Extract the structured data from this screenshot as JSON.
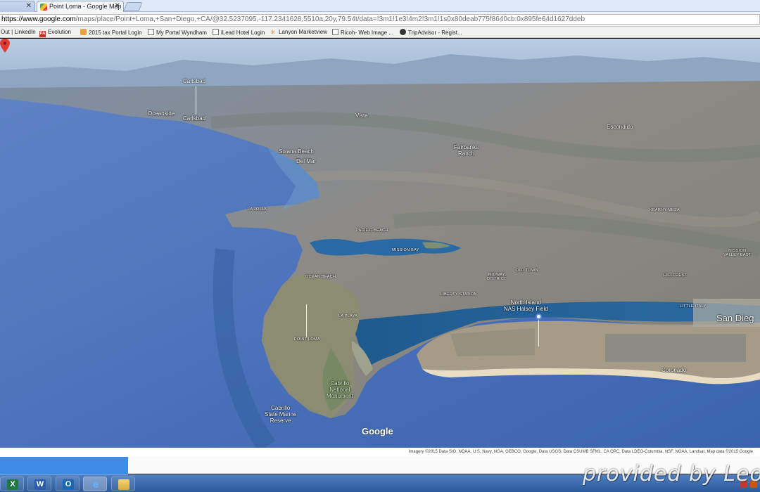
{
  "browser": {
    "tabs": [
      {
        "label": "",
        "active": false
      },
      {
        "label": "Point Loma - Google Map",
        "active": true
      }
    ],
    "close_glyph": "✕",
    "url_host": "https://www.google.com",
    "url_path": "/maps/place/Point+Loma,+San+Diego,+CA/@32.5237095,-117.2341628,5510a,20y,79.54t/data=!3m1!1e3!4m2!3m1!1s0x80deab775f8640cb:0x895fe64d1627ddeb"
  },
  "bookmarks": [
    {
      "label": "Out | LinkedIn",
      "icon": "none"
    },
    {
      "label": "Evolution",
      "icon": "pa-icon"
    },
    {
      "label": "2015 tax  Portal Login",
      "icon": "briefcase-icon"
    },
    {
      "label": "My Portal Wyndham",
      "icon": "document-icon"
    },
    {
      "label": "iLead Hotel Login",
      "icon": "document-icon"
    },
    {
      "label": "Lanyon Marketview",
      "icon": "lanyon-icon"
    },
    {
      "label": "Ricoh- Web Image ...",
      "icon": "document-icon"
    },
    {
      "label": "TripAdvisor - Regist...",
      "icon": "owl-icon"
    }
  ],
  "map": {
    "labels": {
      "carlsbad_1": "Carlsbad",
      "carlsbad_2": "Carlsbad",
      "oceanside": "Oceanside",
      "vista": "Vista",
      "escondido": "Escondido",
      "solana_beach": "Solana Beach",
      "del_mar": "Del Mar",
      "fairbanks_ranch": "Fairbanks\nRanch",
      "la_jolla": "LA JOLLA",
      "pacific_beach": "PACIFIC BEACH",
      "kearny_mesa": "KEARNY MESA",
      "mission_bay": "MISSION BAY",
      "mission_valley": "MISSION\nVALLEY EAST",
      "ocean_beach": "OCEAN BEACH",
      "old_town": "OLD TOWN",
      "midway_district": "MIDWAY\nDISTRICT",
      "hillcrest": "HILLCREST",
      "liberty_station": "LIBERTY STATION",
      "north_island": "North Island\nNAS Halsey Field",
      "little_italy": "LITTLE ITALY",
      "san_diego": "San Dieg",
      "la_playa": "LA PLAYA",
      "point_loma": "POINT LOMA",
      "cabrillo_monument": "Cabrillo\nNational\nMonument",
      "cabrillo_reserve": "Cabrillo\nState Marine\nReserve",
      "coronado": "Coronado"
    },
    "logo": "Google",
    "attribution": "Imagery ©2015 Data SIO, NOAA, U.S. Navy, NGA, GEBCO, Google, Data USGS, Data CSUMB SFML, CA OPC, Data LDEO-Columbia, NSF, NOAA, Landsat, Map data ©2015 Google"
  },
  "taskbar": {
    "apps": [
      {
        "name": "excel",
        "glyph": "X"
      },
      {
        "name": "word",
        "glyph": "W"
      },
      {
        "name": "outlook",
        "glyph": "O"
      },
      {
        "name": "internet-explorer",
        "glyph": "e"
      },
      {
        "name": "file-explorer",
        "glyph": ""
      }
    ]
  },
  "watermark": "provided by Leon"
}
